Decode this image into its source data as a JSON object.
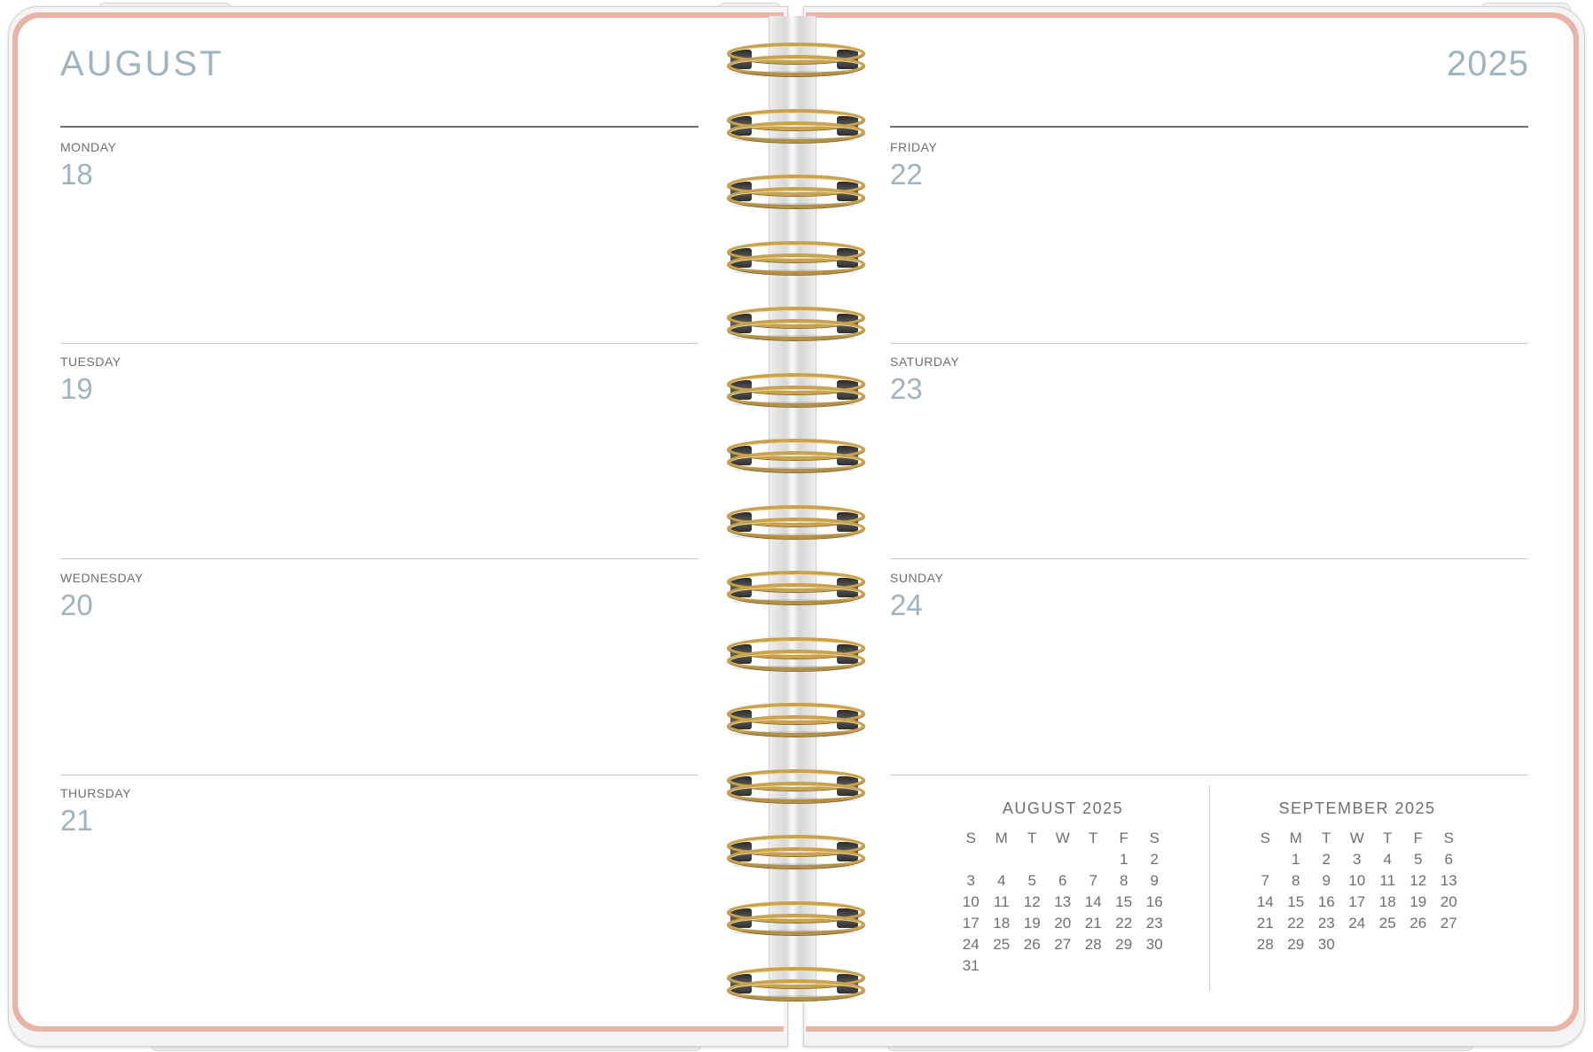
{
  "planner": {
    "month": "AUGUST",
    "year": "2025",
    "left_days": [
      {
        "name": "MONDAY",
        "num": "18"
      },
      {
        "name": "TUESDAY",
        "num": "19"
      },
      {
        "name": "WEDNESDAY",
        "num": "20"
      },
      {
        "name": "THURSDAY",
        "num": "21"
      }
    ],
    "right_days": [
      {
        "name": "FRIDAY",
        "num": "22"
      },
      {
        "name": "SATURDAY",
        "num": "23"
      },
      {
        "name": "SUNDAY",
        "num": "24"
      }
    ]
  },
  "mini_calendars": [
    {
      "title": "AUGUST 2025",
      "weekdays": [
        "S",
        "M",
        "T",
        "W",
        "T",
        "F",
        "S"
      ],
      "weeks": [
        [
          "",
          "",
          "",
          "",
          "",
          "1",
          "2"
        ],
        [
          "3",
          "4",
          "5",
          "6",
          "7",
          "8",
          "9"
        ],
        [
          "10",
          "11",
          "12",
          "13",
          "14",
          "15",
          "16"
        ],
        [
          "17",
          "18",
          "19",
          "20",
          "21",
          "22",
          "23"
        ],
        [
          "24",
          "25",
          "26",
          "27",
          "28",
          "29",
          "30"
        ],
        [
          "31",
          "",
          "",
          "",
          "",
          "",
          ""
        ]
      ]
    },
    {
      "title": "SEPTEMBER 2025",
      "weekdays": [
        "S",
        "M",
        "T",
        "W",
        "T",
        "F",
        "S"
      ],
      "weeks": [
        [
          "",
          "1",
          "2",
          "3",
          "4",
          "5",
          "6"
        ],
        [
          "7",
          "8",
          "9",
          "10",
          "11",
          "12",
          "13"
        ],
        [
          "14",
          "15",
          "16",
          "17",
          "18",
          "19",
          "20"
        ],
        [
          "21",
          "22",
          "23",
          "24",
          "25",
          "26",
          "27"
        ],
        [
          "28",
          "29",
          "30",
          "",
          "",
          "",
          ""
        ]
      ]
    }
  ],
  "colors": {
    "accent_blue_gray": "#9fb3c0",
    "cover_pink": "#e9b3a6",
    "coil_gold": "#c8a24e",
    "text_gray": "#6f6f6f"
  }
}
